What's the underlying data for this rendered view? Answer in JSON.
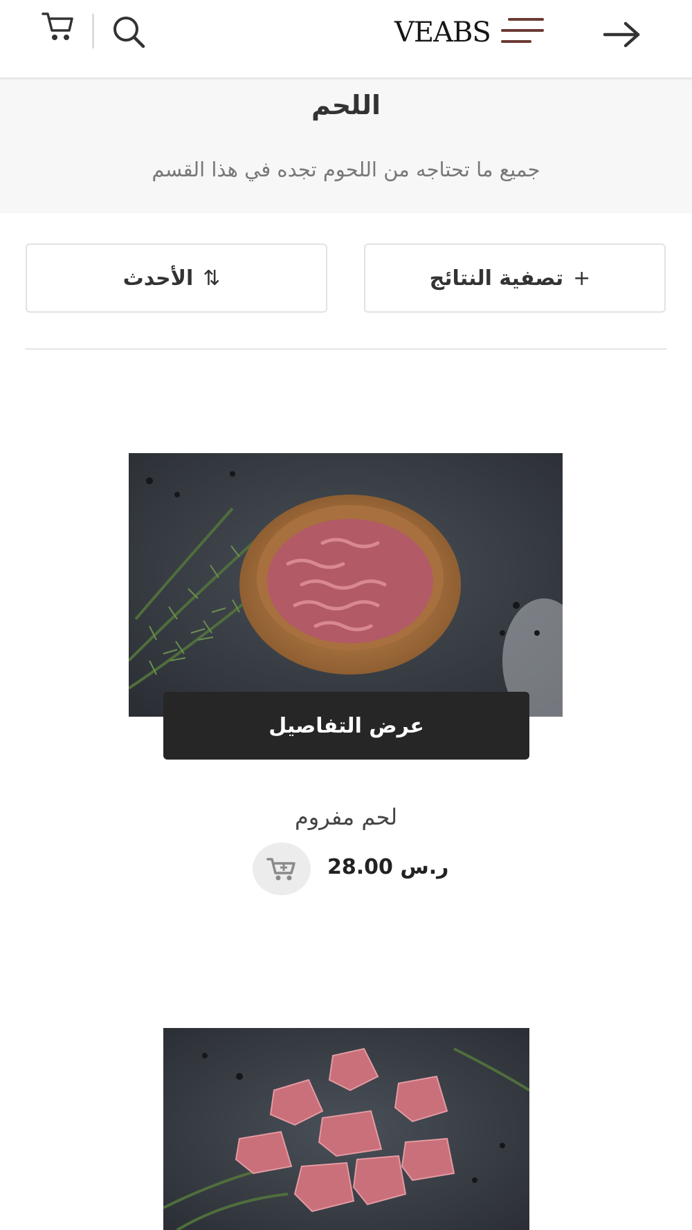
{
  "header": {
    "logo_text": "VEABS",
    "icons": [
      "cart-icon",
      "search-icon",
      "menu-icon",
      "back-arrow-icon"
    ]
  },
  "category": {
    "title": "اللحم",
    "subtitle": "جميع ما تحتاجه من اللحوم تجده في هذا القسم"
  },
  "controls": {
    "filter_label": "تصفية النتائج",
    "filter_icon": "+",
    "sort_label": "الأحدث",
    "sort_icon": "⇅"
  },
  "products": [
    {
      "name": "لحم مفروم",
      "price": "28.00 ر.س",
      "details_label": "عرض التفاصيل"
    }
  ],
  "colors": {
    "header_bg": "#ffffff",
    "banner_bg": "#f7f7f7",
    "button_dark": "#262626",
    "menu_icon": "#6b3a34",
    "add_to_cart_bg": "#ececec"
  }
}
